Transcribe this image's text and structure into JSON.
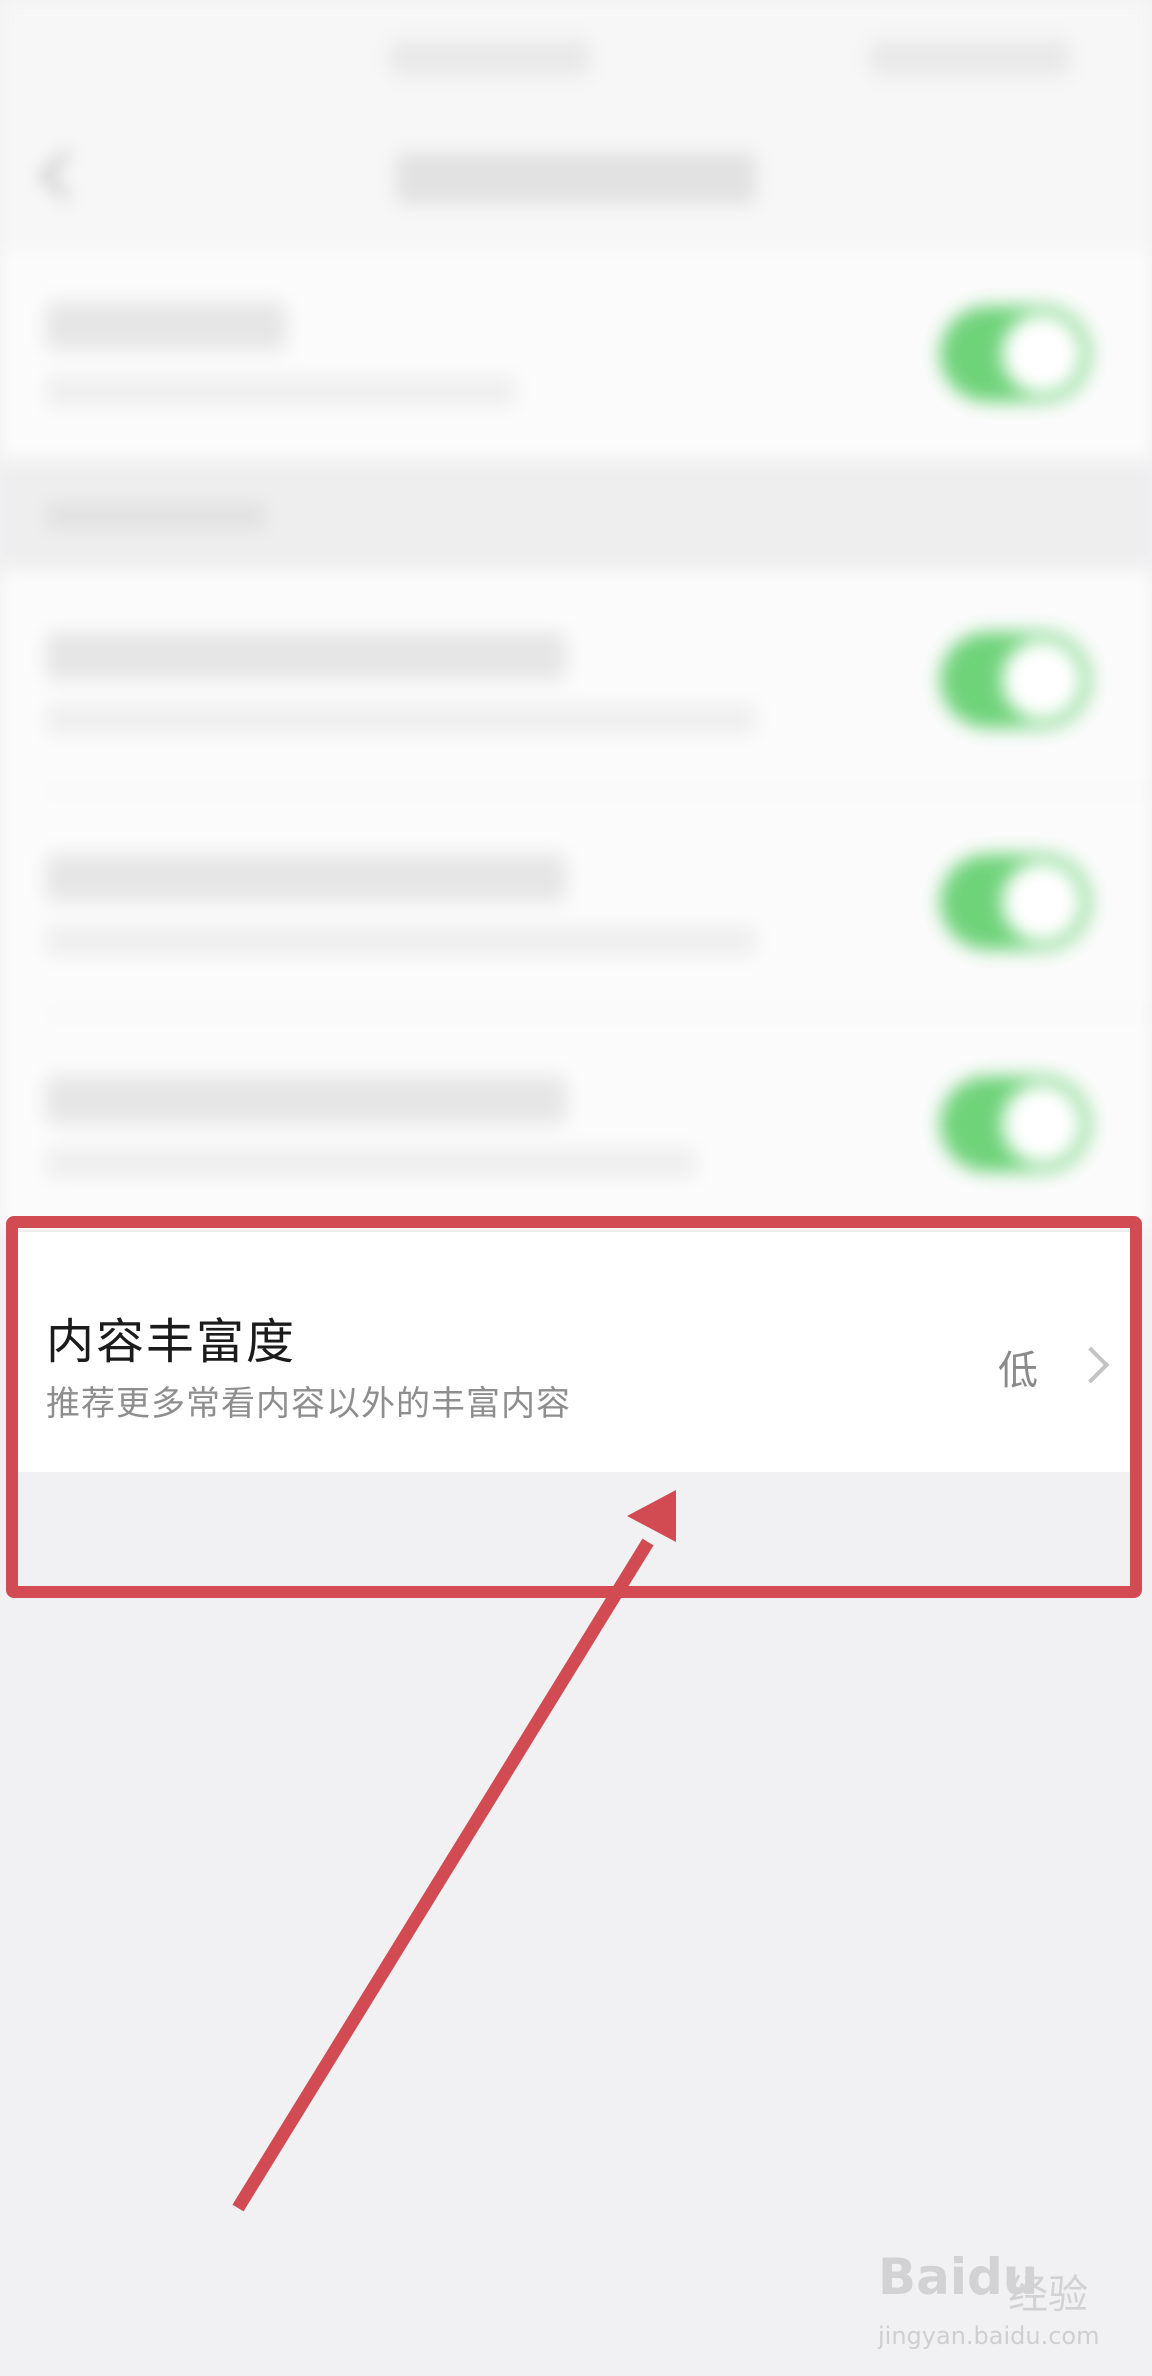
{
  "status_bar": {
    "left": "",
    "right": ""
  },
  "nav": {
    "title": ""
  },
  "personalized": {
    "title": "",
    "subtitle": "",
    "enabled": true
  },
  "group_header": "",
  "toggle_rows": [
    {
      "title": "",
      "subtitle": "",
      "enabled": true
    },
    {
      "title": "",
      "subtitle": "",
      "enabled": true
    },
    {
      "title": "",
      "subtitle": "",
      "enabled": true
    }
  ],
  "content_richness": {
    "title": "内容丰富度",
    "subtitle": "推荐更多常看内容以外的丰富内容",
    "value": "低"
  },
  "annotation": {
    "color": "#d24b52"
  },
  "colors": {
    "toggle_on": "#6fd37a",
    "page_bg": "#f1f1f3"
  },
  "watermark": {
    "logo": "Bai",
    "logo_suffix": "du",
    "cn": "经验",
    "url": "jingyan.baidu.com"
  }
}
